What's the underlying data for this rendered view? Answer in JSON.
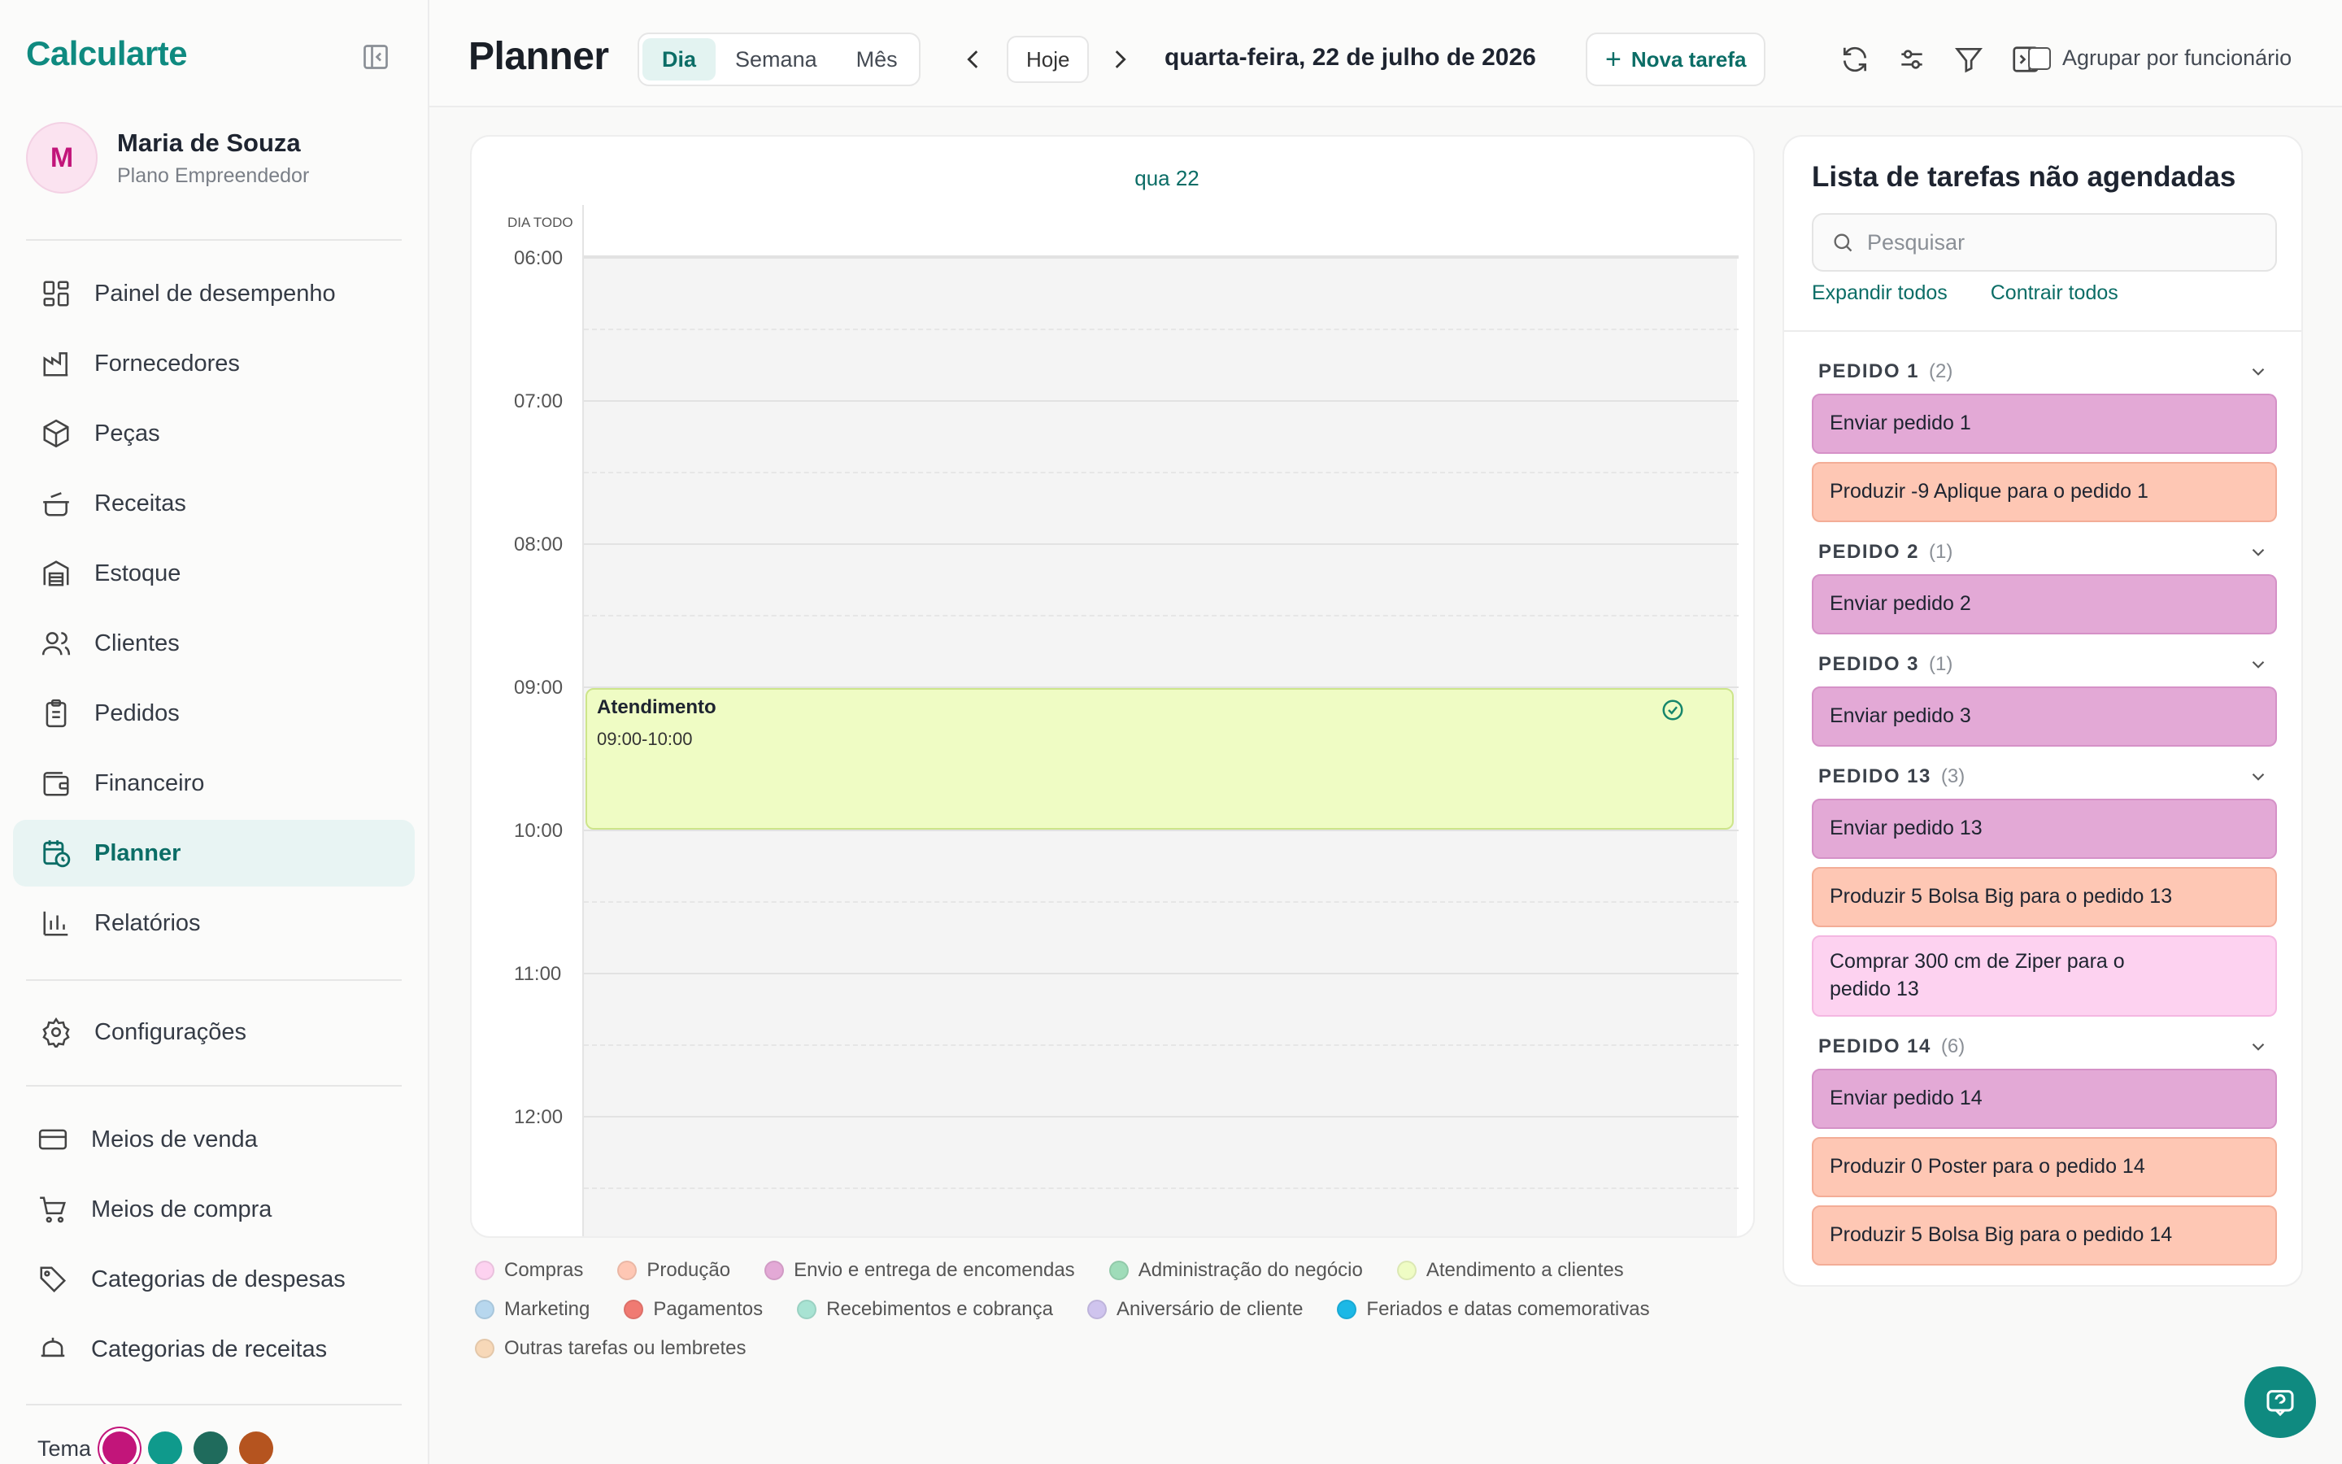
{
  "sidebar": {
    "brand": "Calcularte",
    "user": {
      "initial": "M",
      "name": "Maria de Souza",
      "plan": "Plano Empreendedor"
    },
    "items": [
      {
        "label": "Painel de desempenho",
        "icon": "dashboard-icon"
      },
      {
        "label": "Fornecedores",
        "icon": "factory-icon"
      },
      {
        "label": "Peças",
        "icon": "box-icon"
      },
      {
        "label": "Receitas",
        "icon": "pot-icon"
      },
      {
        "label": "Estoque",
        "icon": "warehouse-icon"
      },
      {
        "label": "Clientes",
        "icon": "users-icon"
      },
      {
        "label": "Pedidos",
        "icon": "clipboard-icon"
      },
      {
        "label": "Financeiro",
        "icon": "wallet-icon"
      },
      {
        "label": "Planner",
        "icon": "calendar-clock-icon",
        "active": true
      },
      {
        "label": "Relatórios",
        "icon": "bar-chart-icon"
      }
    ],
    "settings": {
      "label": "Configurações",
      "icon": "gear-icon"
    },
    "secondary": [
      {
        "label": "Meios de venda",
        "icon": "card-icon"
      },
      {
        "label": "Meios de compra",
        "icon": "cart-icon"
      },
      {
        "label": "Categorias de despesas",
        "icon": "tag-icon"
      },
      {
        "label": "Categorias de receitas",
        "icon": "piggy-icon"
      }
    ],
    "theme": {
      "label": "Tema",
      "colors": [
        "#c2157a",
        "#0f9a8c",
        "#1f6b5c",
        "#b5541f"
      ]
    }
  },
  "header": {
    "title": "Planner",
    "views": [
      "Dia",
      "Semana",
      "Mês"
    ],
    "active_view": "Dia",
    "today": "Hoje",
    "date": "quarta-feira, 22 de julho de 2026",
    "new_task": "Nova tarefa",
    "group_by": "Agrupar por funcionário"
  },
  "calendar": {
    "day_label": "qua 22",
    "all_day": "DIA TODO",
    "hours": [
      "06:00",
      "07:00",
      "08:00",
      "09:00",
      "10:00",
      "11:00",
      "12:00"
    ],
    "event": {
      "title": "Atendimento",
      "time": "09:00-10:00",
      "color": "#effcc4"
    }
  },
  "legend": [
    {
      "label": "Compras",
      "color": "#fdd2f0"
    },
    {
      "label": "Produção",
      "color": "#fec7b4"
    },
    {
      "label": "Envio e entrega de encomendas",
      "color": "#e3a9d6"
    },
    {
      "label": "Administração do negócio",
      "color": "#9fdcb9"
    },
    {
      "label": "Atendimento a clientes",
      "color": "#effcc4"
    },
    {
      "label": "Marketing",
      "color": "#b7d7ee"
    },
    {
      "label": "Pagamentos",
      "color": "#f07a72"
    },
    {
      "label": "Recebimentos e cobrança",
      "color": "#a8e3d3"
    },
    {
      "label": "Aniversário de cliente",
      "color": "#cfc4ee"
    },
    {
      "label": "Feriados e datas comemorativas",
      "color": "#1cb8e6"
    },
    {
      "label": "Outras tarefas ou lembretes",
      "color": "#f7d8b8"
    }
  ],
  "unscheduled": {
    "title": "Lista de tarefas não agendadas",
    "search_placeholder": "Pesquisar",
    "expand_all": "Expandir todos",
    "collapse_all": "Contrair todos",
    "groups": [
      {
        "name": "PEDIDO 1",
        "count": "(2)",
        "tasks": [
          {
            "label": "Enviar pedido 1",
            "type": "envio"
          },
          {
            "label": "Produzir -9 Aplique para o pedido 1",
            "type": "producao"
          }
        ]
      },
      {
        "name": "PEDIDO 2",
        "count": "(1)",
        "tasks": [
          {
            "label": "Enviar pedido 2",
            "type": "envio"
          }
        ]
      },
      {
        "name": "PEDIDO 3",
        "count": "(1)",
        "tasks": [
          {
            "label": "Enviar pedido 3",
            "type": "envio"
          }
        ]
      },
      {
        "name": "PEDIDO 13",
        "count": "(3)",
        "tasks": [
          {
            "label": "Enviar pedido 13",
            "type": "envio"
          },
          {
            "label": "Produzir 5 Bolsa Big para o pedido 13",
            "type": "producao"
          },
          {
            "label": "Comprar 300 cm de Ziper para o pedido 13",
            "type": "compras"
          }
        ]
      },
      {
        "name": "PEDIDO 14",
        "count": "(6)",
        "tasks": [
          {
            "label": "Enviar pedido 14",
            "type": "envio"
          },
          {
            "label": "Produzir 0 Poster para o pedido 14",
            "type": "producao"
          },
          {
            "label": "Produzir 5 Bolsa Big para o pedido 14",
            "type": "producao"
          }
        ]
      }
    ]
  }
}
